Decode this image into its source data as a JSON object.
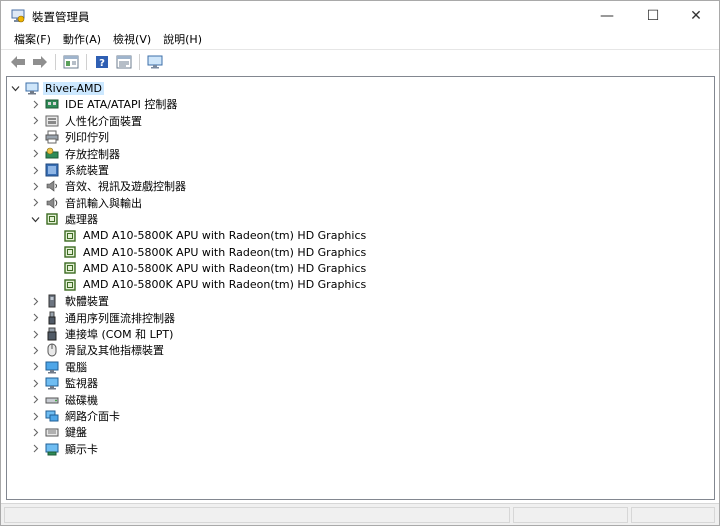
{
  "window": {
    "title": "裝置管理員",
    "buttons": {
      "minimize": "—",
      "maximize": "☐",
      "close": "✕"
    }
  },
  "menu": [
    "檔案(F)",
    "動作(A)",
    "檢視(V)",
    "說明(H)"
  ],
  "toolbar": [
    "back-icon",
    "forward-icon",
    "properties-icon",
    "help-icon",
    "details-icon",
    "monitor-icon"
  ],
  "tree": {
    "root": {
      "label": "River-AMD",
      "expanded": true,
      "icon": "computer-icon"
    },
    "categories": [
      {
        "label": "IDE ATA/ATAPI 控制器",
        "icon": "ide-controller-icon",
        "expanded": false
      },
      {
        "label": "人性化介面裝置",
        "icon": "hid-icon",
        "expanded": false
      },
      {
        "label": "列印佇列",
        "icon": "printer-icon",
        "expanded": false
      },
      {
        "label": "存放控制器",
        "icon": "storage-controller-icon",
        "expanded": false
      },
      {
        "label": "系統裝置",
        "icon": "system-device-icon",
        "expanded": false
      },
      {
        "label": "音效、視訊及遊戲控制器",
        "icon": "speaker-icon",
        "expanded": false
      },
      {
        "label": "音訊輸入與輸出",
        "icon": "audio-io-icon",
        "expanded": false
      },
      {
        "label": "處理器",
        "icon": "processor-icon",
        "expanded": true,
        "children": [
          "AMD A10-5800K APU with Radeon(tm) HD Graphics",
          "AMD A10-5800K APU with Radeon(tm) HD Graphics",
          "AMD A10-5800K APU with Radeon(tm) HD Graphics",
          "AMD A10-5800K APU with Radeon(tm) HD Graphics"
        ]
      },
      {
        "label": "軟體裝置",
        "icon": "software-device-icon",
        "expanded": false
      },
      {
        "label": "通用序列匯流排控制器",
        "icon": "usb-icon",
        "expanded": false
      },
      {
        "label": "連接埠 (COM 和 LPT)",
        "icon": "port-icon",
        "expanded": false
      },
      {
        "label": "滑鼠及其他指標裝置",
        "icon": "mouse-icon",
        "expanded": false
      },
      {
        "label": "電腦",
        "icon": "computer-monitor-icon",
        "expanded": false
      },
      {
        "label": "監視器",
        "icon": "monitor-icon",
        "expanded": false
      },
      {
        "label": "磁碟機",
        "icon": "disk-drive-icon",
        "expanded": false
      },
      {
        "label": "網路介面卡",
        "icon": "network-adapter-icon",
        "expanded": false
      },
      {
        "label": "鍵盤",
        "icon": "keyboard-icon",
        "expanded": false
      },
      {
        "label": "顯示卡",
        "icon": "display-adapter-icon",
        "expanded": false
      }
    ]
  },
  "colors": {
    "selection": "#cce8ff",
    "accent": "#1e90ff"
  }
}
